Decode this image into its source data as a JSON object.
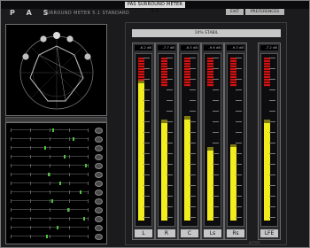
{
  "window": {
    "title": "PAS SURROUND METER 5.1",
    "buttons": [
      "EXIT",
      "PREFERENCES"
    ],
    "brand": "P A S",
    "subtitle": "SURROUND METER 5.1 STANDARD"
  },
  "topbar": {
    "label": "10% STABIL"
  },
  "meters": [
    {
      "name": "L",
      "value_text": "-6.2 dB",
      "level": 0.84,
      "peak": 0.86
    },
    {
      "name": "R",
      "value_text": "-7.7 dB",
      "level": 0.6,
      "peak": 0.62
    },
    {
      "name": "C",
      "value_text": "-6.5 dB",
      "level": 0.62,
      "peak": 0.64
    },
    {
      "name": "Ls",
      "value_text": "-9.6 dB",
      "level": 0.43,
      "peak": 0.45
    },
    {
      "name": "Rs",
      "value_text": "-9.3 dB",
      "level": 0.45,
      "peak": 0.47
    },
    {
      "name": "LFE",
      "value_text": "-7.2 dB",
      "level": 0.6,
      "peak": 0.62
    }
  ],
  "footer": {
    "text": "ACTIVE"
  }
}
